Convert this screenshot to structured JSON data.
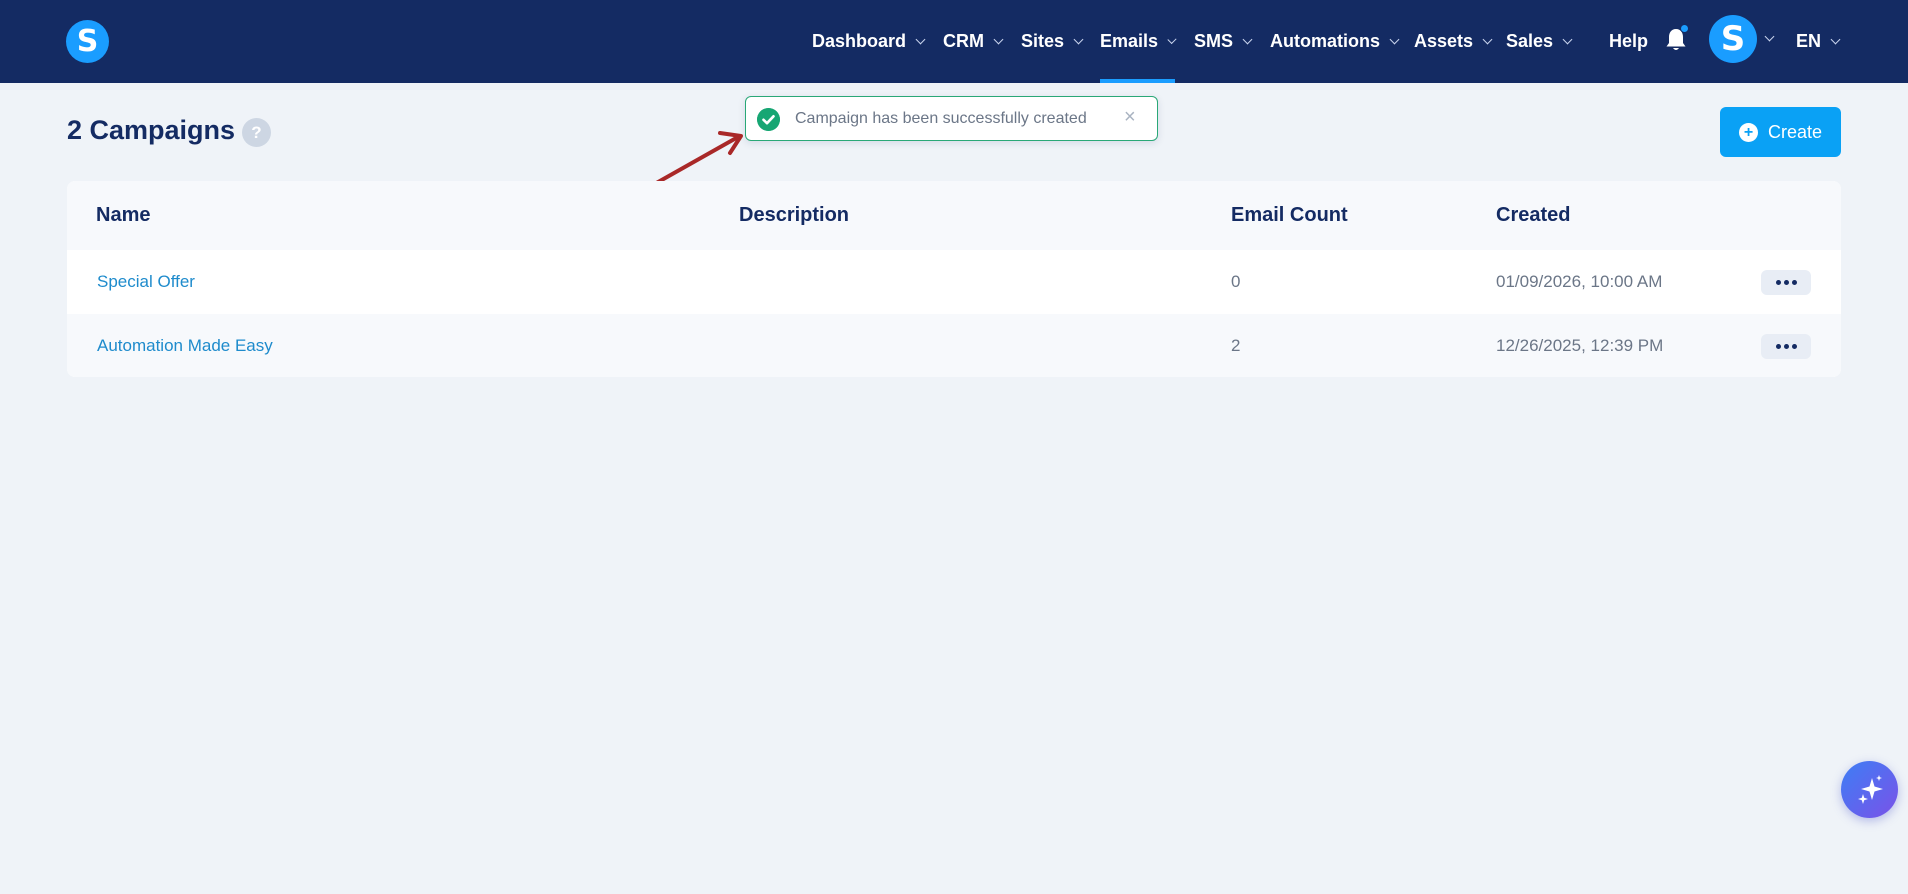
{
  "app": {
    "logo_letter": "S"
  },
  "nav": {
    "items": [
      {
        "label": "Dashboard"
      },
      {
        "label": "CRM"
      },
      {
        "label": "Sites"
      },
      {
        "label": "Emails"
      },
      {
        "label": "SMS"
      },
      {
        "label": "Automations"
      },
      {
        "label": "Assets"
      },
      {
        "label": "Sales"
      }
    ],
    "active": "Emails",
    "help": "Help",
    "avatar_letter": "S",
    "language": "EN"
  },
  "header": {
    "title": "2 Campaigns",
    "help_badge": "?",
    "create_label": "Create"
  },
  "toast": {
    "message": "Campaign has been successfully created",
    "close": "×",
    "status": "success"
  },
  "table": {
    "columns": [
      "Name",
      "Description",
      "Email Count",
      "Created"
    ],
    "rows": [
      {
        "name": "Special Offer",
        "description": "",
        "email_count": "0",
        "created": "01/09/2026, 10:00 AM"
      },
      {
        "name": "Automation Made Easy",
        "description": "",
        "email_count": "2",
        "created": "12/26/2025, 12:39 PM"
      }
    ]
  },
  "colors": {
    "topbar": "#142b63",
    "accent": "#1a9dff",
    "primary_button": "#0aa1f5",
    "success": "#17a673",
    "link": "#1e8bcc",
    "annotation_arrow": "#a92828"
  }
}
